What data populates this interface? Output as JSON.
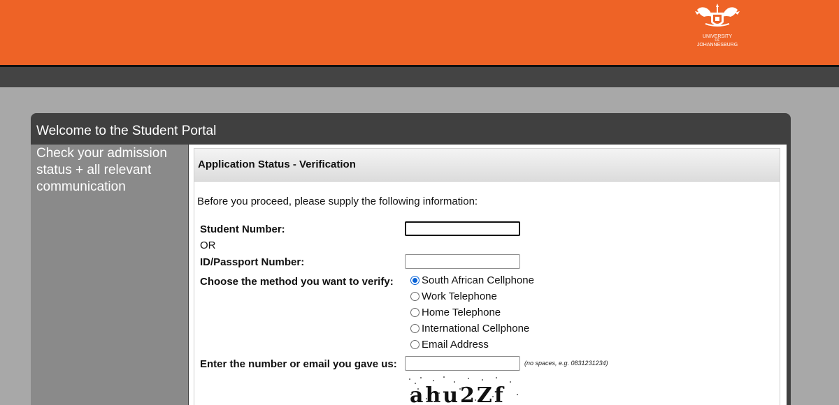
{
  "header": {
    "logo": {
      "icon": "university-crest-icon",
      "line1": "UNIVERSITY",
      "line2": "OF",
      "line3": "JOHANNESBURG"
    },
    "accent_color": "#ee6326"
  },
  "portal": {
    "title": "Welcome to the Student Portal",
    "sidebar_text": "Check your admission status + all relevant communication"
  },
  "form": {
    "title": "Application Status - Verification",
    "intro": "Before you proceed, please supply the following information:",
    "student_number_label": "Student Number:",
    "student_number_value": "",
    "or_label": "OR",
    "id_label": "ID/Passport Number:",
    "id_value": "",
    "method_label": "Choose the method you want to verify:",
    "methods": [
      {
        "label": "South African Cellphone",
        "selected": true
      },
      {
        "label": "Work Telephone",
        "selected": false
      },
      {
        "label": "Home Telephone",
        "selected": false
      },
      {
        "label": "International Cellphone",
        "selected": false
      },
      {
        "label": "Email Address",
        "selected": false
      }
    ],
    "contact_label": "Enter the number or email you gave us:",
    "contact_value": "",
    "contact_hint": "(no spaces, e.g. 0831231234)",
    "captcha_text": "ahu2Zf"
  }
}
